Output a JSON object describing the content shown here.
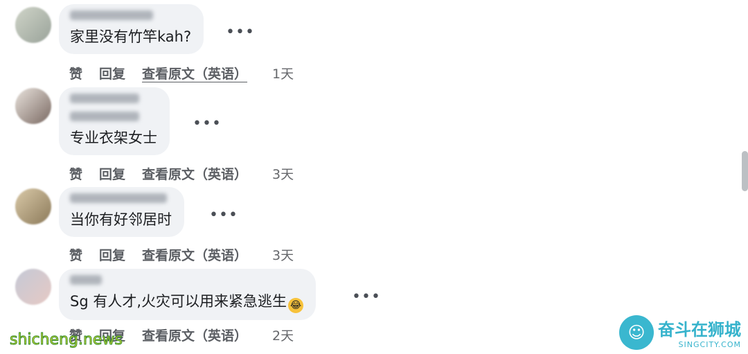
{
  "comments": [
    {
      "text": "家里没有竹竿kah?",
      "actions": {
        "like": "赞",
        "reply": "回复",
        "translate": "查看原文（英语）",
        "time": "1天"
      }
    },
    {
      "text": "专业衣架女士",
      "actions": {
        "like": "赞",
        "reply": "回复",
        "translate": "查看原文（英语）",
        "time": "3天"
      }
    },
    {
      "text": "当你有好邻居时",
      "actions": {
        "like": "赞",
        "reply": "回复",
        "translate": "查看原文（英语）",
        "time": "3天"
      }
    },
    {
      "text": "Sg 有人才,火灾可以用来紧急逃生",
      "actions": {
        "like": "赞",
        "reply": "回复",
        "translate": "查看原文（英语）",
        "time": "2天"
      }
    }
  ],
  "more_glyph": "•••",
  "watermarks": {
    "left": "shicheng.news",
    "right_cn": "奋斗在狮城",
    "right_en": "SINGCITY.COM"
  },
  "icons": {
    "emoji": "rolling-on-floor-laughing-icon",
    "more": "more-options-icon"
  }
}
